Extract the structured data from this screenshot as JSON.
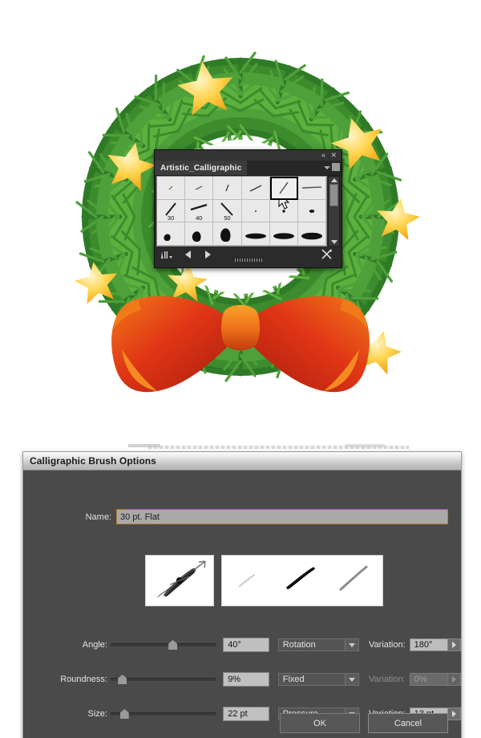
{
  "artwork": {
    "name": "christmas-wreath-illustration",
    "description": "Green pine wreath with gold stars and red-orange bow",
    "colors": {
      "pine_dark": "#2f7a26",
      "pine_mid": "#4ea03a",
      "pine_light": "#76c14a",
      "star_gold": "#ffd24a",
      "star_deep": "#f0a81e",
      "bow_red": "#e03516",
      "bow_orange": "#f47a1d",
      "bow_dark": "#a61d0c"
    }
  },
  "brush_panel": {
    "tab_label": "Artistic_Calligraphic",
    "collapse_icon": "double-left-chevron-icon",
    "close_icon": "close-icon",
    "menu_icon": "panel-menu-icon",
    "scrollbar": {
      "up_icon": "scroll-up-arrow-icon",
      "down_icon": "scroll-down-arrow-icon"
    },
    "footer": {
      "library_icon": "brush-libraries-menu-icon",
      "prev_icon": "previous-library-arrow-icon",
      "next_icon": "next-library-arrow-icon",
      "options_icon": "brush-options-icon"
    },
    "brushes": [
      {
        "label": "",
        "kind": "stroke-xs",
        "selected": false
      },
      {
        "label": "",
        "kind": "stroke-xs2",
        "selected": false
      },
      {
        "label": "",
        "kind": "stroke-s",
        "selected": false
      },
      {
        "label": "",
        "kind": "stroke-m",
        "selected": false
      },
      {
        "label": "",
        "kind": "stroke-l",
        "selected": true
      },
      {
        "label": "",
        "kind": "stroke-flat",
        "selected": false
      },
      {
        "label": "30",
        "kind": "stroke-30",
        "selected": false
      },
      {
        "label": "40",
        "kind": "stroke-40",
        "selected": false
      },
      {
        "label": "50",
        "kind": "stroke-50",
        "selected": false
      },
      {
        "label": "",
        "kind": "dot-xs",
        "selected": false
      },
      {
        "label": "",
        "kind": "dot-s",
        "selected": false
      },
      {
        "label": "",
        "kind": "dot-m",
        "selected": false
      },
      {
        "label": "",
        "kind": "blob-s",
        "selected": false
      },
      {
        "label": "",
        "kind": "blob-m",
        "selected": false
      },
      {
        "label": "",
        "kind": "blob-l",
        "selected": false
      },
      {
        "label": "",
        "kind": "ellipse-s",
        "selected": false
      },
      {
        "label": "",
        "kind": "ellipse-m",
        "selected": false
      },
      {
        "label": "",
        "kind": "ellipse-l",
        "selected": false
      }
    ],
    "cursor": "arrow-cursor"
  },
  "dialog": {
    "title": "Calligraphic Brush Options",
    "name_label": "Name:",
    "name_value": "30 pt. Flat",
    "preview": {
      "brush_shape_name": "brush-shape-preview",
      "stroke_samples_name": "stroke-samples-preview"
    },
    "controls": [
      {
        "label": "Angle:",
        "value": "40°",
        "slider_percent": 55,
        "select": "Rotation",
        "variation_label": "Variation:",
        "variation_value": "180°",
        "disabled": false
      },
      {
        "label": "Roundness:",
        "value": "9%",
        "slider_percent": 9,
        "select": "Fixed",
        "variation_label": "Variation:",
        "variation_value": "0%",
        "disabled": true
      },
      {
        "label": "Size:",
        "value": "22 pt",
        "slider_percent": 11,
        "select": "Pressure",
        "variation_label": "Variation:",
        "variation_value": "13 pt",
        "disabled": false
      }
    ],
    "ok_label": "OK",
    "cancel_label": "Cancel"
  }
}
